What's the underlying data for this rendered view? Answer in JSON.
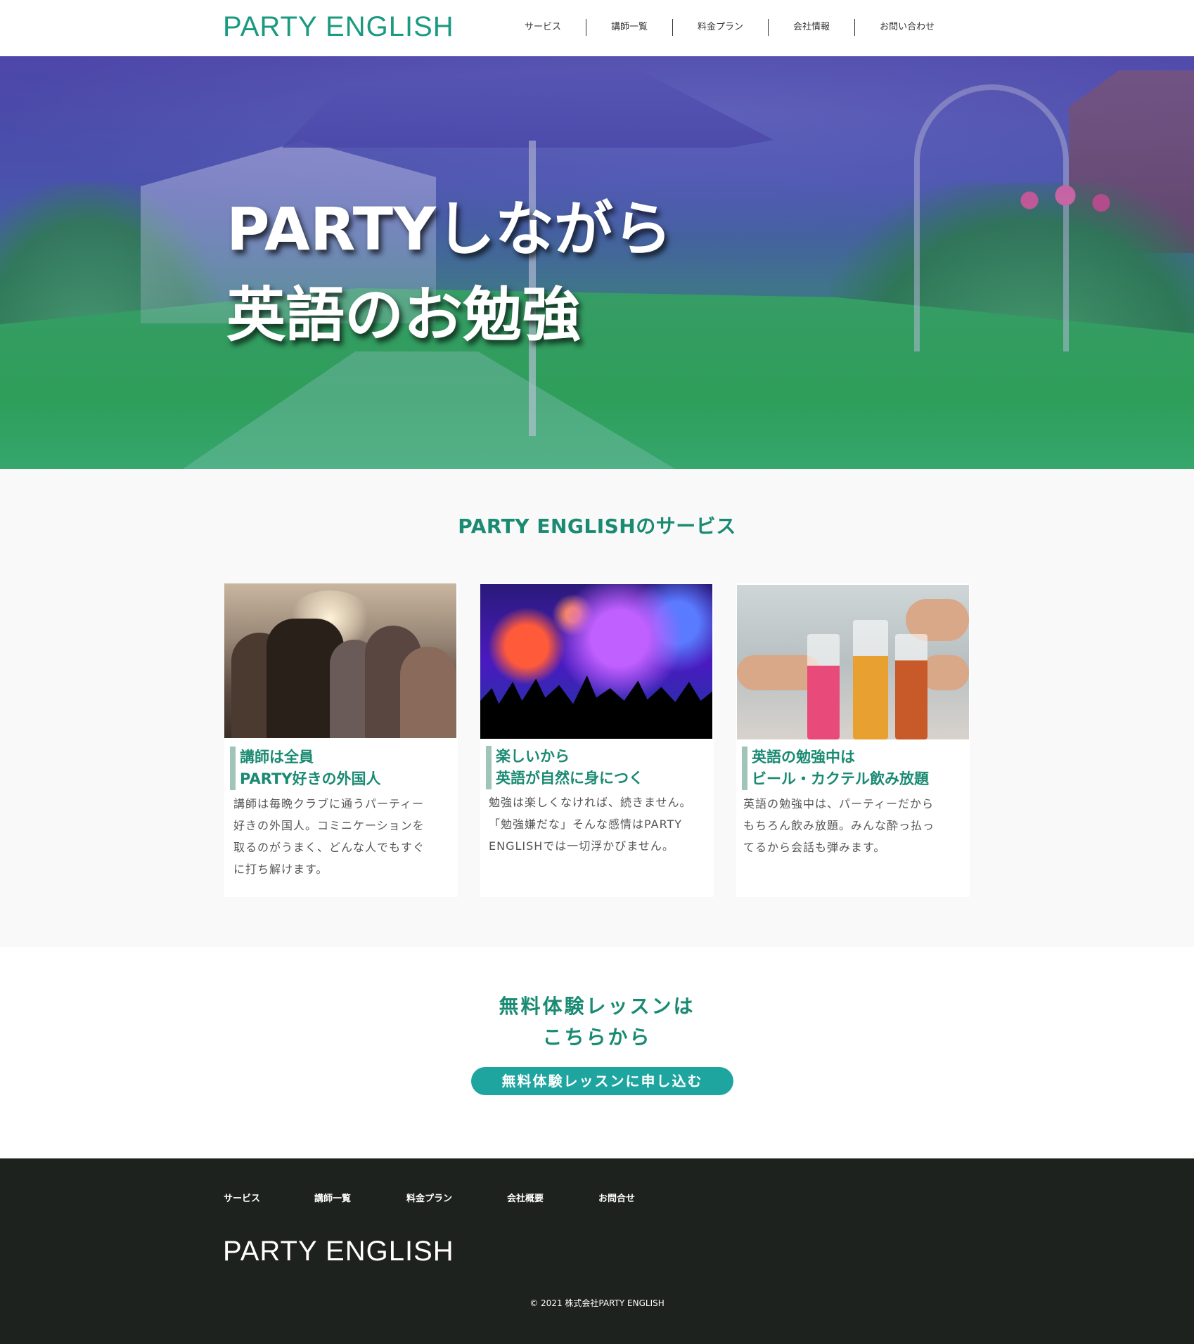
{
  "header": {
    "logo": "PARTY ENGLISH",
    "nav": [
      {
        "label": "サービス"
      },
      {
        "label": "講師一覧"
      },
      {
        "label": "料金プラン"
      },
      {
        "label": "会社情報"
      },
      {
        "label": "お問い合わせ"
      }
    ]
  },
  "hero": {
    "line1": "PARTYしながら",
    "line2": "英語のお勉強"
  },
  "services": {
    "title": "PARTY ENGLISHのサービス",
    "cards": [
      {
        "heading1": "講師は全員",
        "heading2": "PARTY好きの外国人",
        "body": [
          "講師は毎晩クラブに通うパーティー",
          "好きの外国人。コミニケーションを",
          "取るのがうまく、どんな人でもすぐ",
          "に打ち解けます。"
        ]
      },
      {
        "heading1": "楽しいから",
        "heading2": "英語が自然に身につく",
        "body": [
          "勉強は楽しくなければ、続きません。",
          "「勉強嫌だな」そんな感情はPARTY",
          "ENGLISHでは一切浮かびません。"
        ]
      },
      {
        "heading1": "英語の勉強中は",
        "heading2": "ビール・カクテル飲み放題",
        "body": [
          "英語の勉強中は、パーティーだから",
          "もちろん飲み放題。みんな酔っ払っ",
          "てるから会話も弾みます。"
        ]
      }
    ]
  },
  "trial": {
    "title_line1": "無料体験レッスンは",
    "title_line2": "こちらから",
    "button": "無料体験レッスンに申し込む"
  },
  "footer": {
    "nav": [
      {
        "label": "サービス"
      },
      {
        "label": "講師一覧"
      },
      {
        "label": "料金プラン"
      },
      {
        "label": "会社概要"
      },
      {
        "label": "お問合せ"
      }
    ],
    "logo": "PARTY ENGLISH",
    "copyright": "© 2021 株式会社PARTY ENGLISH"
  },
  "colors": {
    "accent": "#1a8a72",
    "logo": "#1a9a80",
    "button": "#1fa5a0",
    "footer_bg": "#1e221e"
  }
}
